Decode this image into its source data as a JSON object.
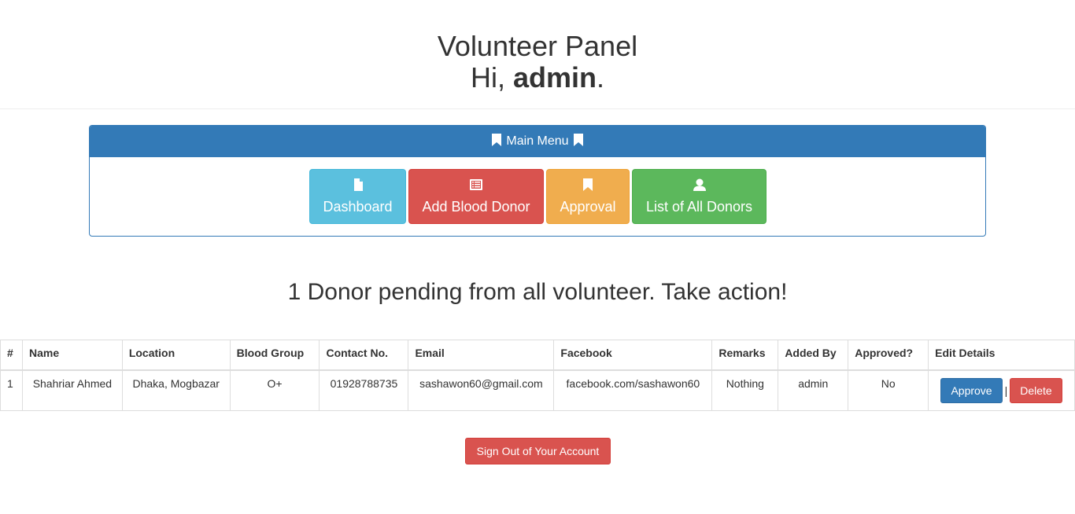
{
  "header": {
    "title": "Volunteer Panel",
    "greeting_prefix": "Hi, ",
    "username": "admin",
    "greeting_suffix": "."
  },
  "menu": {
    "title": "Main Menu",
    "buttons": [
      {
        "label": "Dashboard",
        "icon": "file-icon",
        "color": "#5bc0de"
      },
      {
        "label": "Add Blood Donor",
        "icon": "list-alt-icon",
        "color": "#d9534f"
      },
      {
        "label": "Approval",
        "icon": "bookmark-icon",
        "color": "#f0ad4e"
      },
      {
        "label": "List of All Donors",
        "icon": "user-icon",
        "color": "#5cb85c"
      }
    ]
  },
  "pending_message": "1 Donor pending from all volunteer. Take action!",
  "table": {
    "columns": [
      "#",
      "Name",
      "Location",
      "Blood Group",
      "Contact No.",
      "Email",
      "Facebook",
      "Remarks",
      "Added By",
      "Approved?",
      "Edit Details"
    ],
    "rows": [
      {
        "num": "1",
        "name": "Shahriar Ahmed",
        "location": "Dhaka, Mogbazar",
        "blood_group": "O+",
        "contact": "01928788735",
        "email": "sashawon60@gmail.com",
        "facebook": "facebook.com/sashawon60",
        "remarks": "Nothing",
        "added_by": "admin",
        "approved": "No",
        "approve_label": "Approve",
        "separator": "|",
        "delete_label": "Delete"
      }
    ]
  },
  "signout_label": "Sign Out of Your Account",
  "colors": {
    "primary": "#337ab7",
    "info": "#5bc0de",
    "danger": "#d9534f",
    "warning": "#f0ad4e",
    "success": "#5cb85c"
  }
}
